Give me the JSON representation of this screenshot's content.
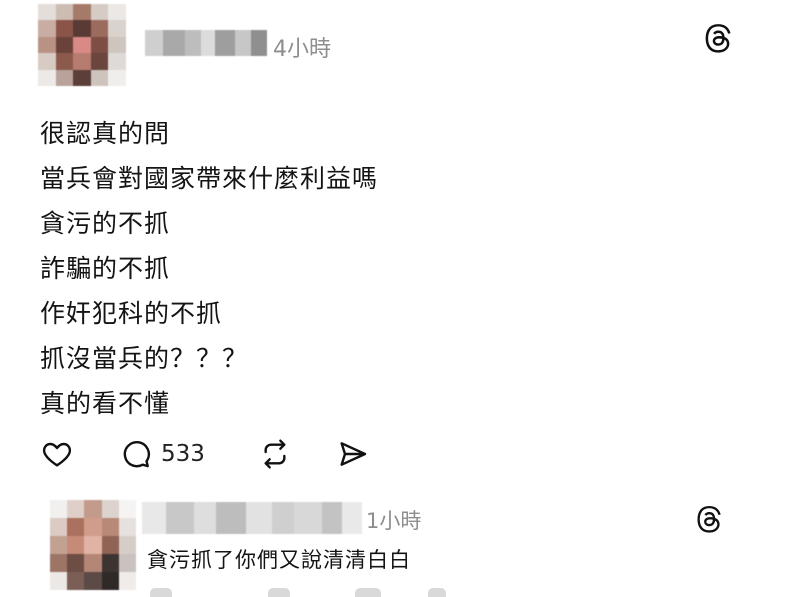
{
  "post": {
    "time": "4小時",
    "lines": [
      "很認真的問",
      "當兵會對國家帶來什麼利益嗎",
      "貪污的不抓",
      "詐騙的不抓",
      "作奸犯科的不抓",
      "抓沒當兵的？？？",
      "真的看不懂"
    ],
    "actions": {
      "like_icon": "heart-icon",
      "comment_icon": "comment-icon",
      "comment_count": "533",
      "repost_icon": "repost-icon",
      "share_icon": "share-icon"
    }
  },
  "reply": {
    "time": "1小時",
    "text": "貪污抓了你們又說清清白白"
  },
  "icons": {
    "brand": "threads-logo-icon"
  },
  "colors": {
    "text": "#111111",
    "muted": "#8e8e8e",
    "background": "#ffffff"
  }
}
